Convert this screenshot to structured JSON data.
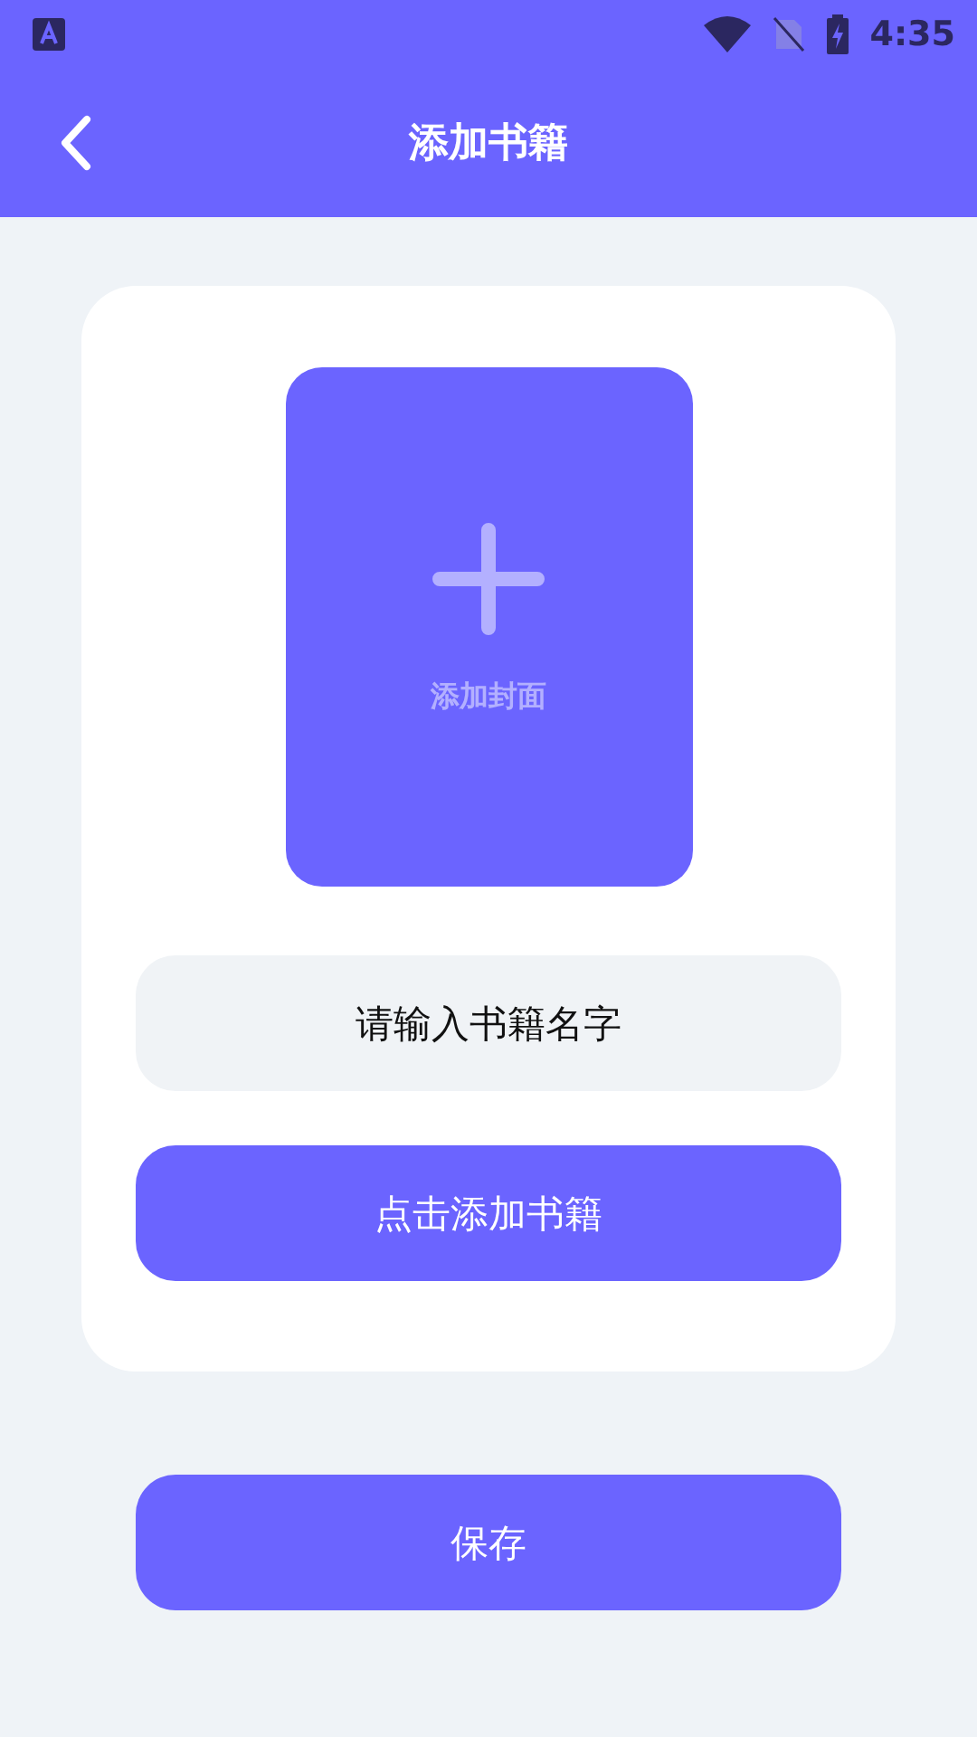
{
  "status_bar": {
    "time": "4:35"
  },
  "header": {
    "title": "添加书籍"
  },
  "cover": {
    "label": "添加封面"
  },
  "name_field": {
    "placeholder": "请输入书籍名字"
  },
  "add_button": {
    "label": "点击添加书籍"
  },
  "save_button": {
    "label": "保存"
  }
}
